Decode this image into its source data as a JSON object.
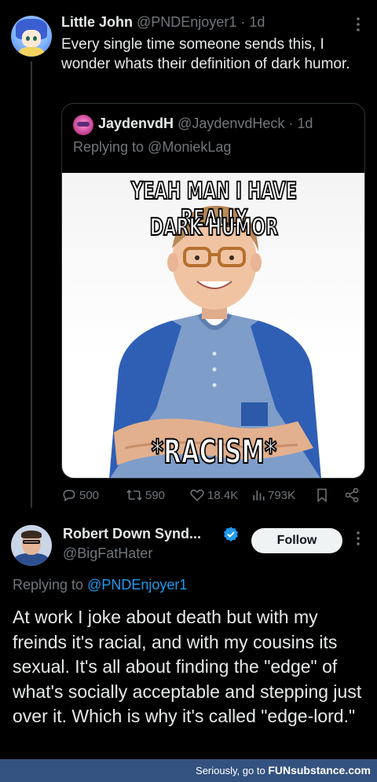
{
  "tweet1": {
    "name": "Little John",
    "handle": "@PNDEnjoyer1",
    "time": " · 1d",
    "text": "Every single time someone sends this, I wonder whats their definition of dark humor.",
    "quote": {
      "name": "JaydenvdH",
      "handle": "@JaydenvdHeck",
      "time": " · 1d",
      "replying_to": "Replying to @MoniekLag",
      "meme": {
        "top_line1": "YEAH MAN I HAVE REALLY",
        "top_line2": "DARK HUMOR",
        "bottom": "*RACISM*"
      }
    },
    "actions": {
      "replies": "500",
      "retweets": "590",
      "likes": "18.4K",
      "views": "793K"
    }
  },
  "tweet2": {
    "name": "Robert Down Synd...",
    "handle": "@BigFatHater",
    "follow_label": "Follow",
    "replying_prefix": "Replying to ",
    "replying_handle": "@PNDEnjoyer1",
    "text": "At work I joke about death but with my freinds it's racial, and with my cousins its sexual. It's all about finding the \"edge\" of what's socially acceptable and stepping just over it. Which is why it's called \"edge-lord.\""
  },
  "footer": {
    "prefix": "Seriously, go to ",
    "brand": "FUNsubstance.com"
  },
  "colors": {
    "background": "#000000",
    "text": "#e7e9ea",
    "muted": "#71767b",
    "link": "#1d9bf0",
    "footer": "#34527f"
  }
}
